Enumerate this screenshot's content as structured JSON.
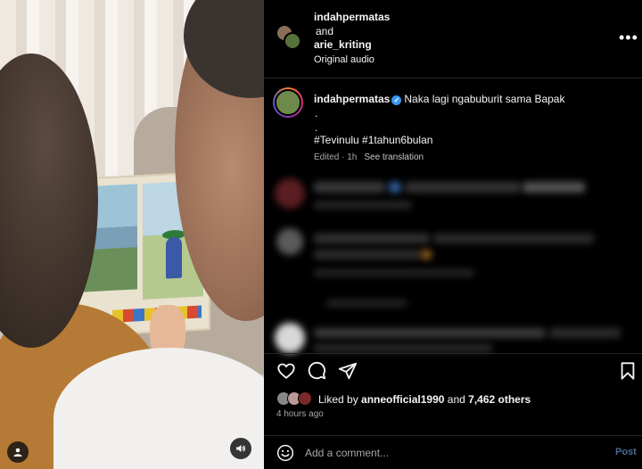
{
  "post": {
    "users": [
      "indahpermatas",
      "arie_kriting"
    ],
    "and_text": "and",
    "audio": "Original audio",
    "more_icon": "more-horizontal-icon"
  },
  "caption": {
    "username": "indahpermatas",
    "verified": true,
    "text": "Naka lagi ngabuburit sama Bapak",
    "line2": ".",
    "line3": ".",
    "hashtags": "#Tevinulu #1tahun6bulan",
    "edited": "Edited · 1h",
    "translate": "See translation"
  },
  "actions": {
    "icons": [
      "heart-icon",
      "comment-icon",
      "share-icon",
      "bookmark-icon"
    ]
  },
  "likes": {
    "prefix": "Liked by",
    "user": "anneofficial1990",
    "suffix": "and",
    "others": "7,462 others",
    "time": "4 hours ago"
  },
  "comment": {
    "placeholder": "Add a comment...",
    "post_label": "Post"
  },
  "colors": {
    "background": "#000000",
    "verified": "#3897f0",
    "post_disabled": "#4c6a8c"
  }
}
